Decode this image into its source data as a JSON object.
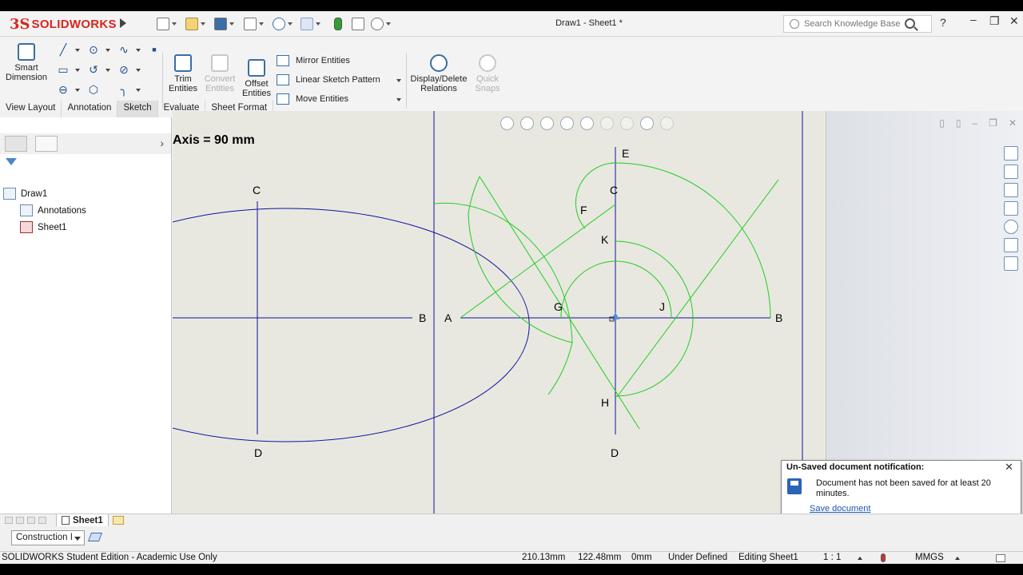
{
  "app": {
    "brand_ds": "3S",
    "brand_name": "SOLIDWORKS",
    "document_title": "Draw1 - Sheet1 *"
  },
  "search": {
    "placeholder": "Search Knowledge Base"
  },
  "command_manager": {
    "smart_dimension": "Smart Dimension",
    "trim_entities": "Trim Entities",
    "convert_entities": "Convert Entities",
    "offset_entities": "Offset Entities",
    "mirror_entities": "Mirror Entities",
    "linear_sketch_pattern": "Linear Sketch Pattern",
    "move_entities": "Move Entities",
    "display_delete_relations": "Display/Delete Relations",
    "quick_snaps": "Quick Snaps"
  },
  "tabs": [
    {
      "label": "View Layout",
      "active": false
    },
    {
      "label": "Annotation",
      "active": false
    },
    {
      "label": "Sketch",
      "active": true
    },
    {
      "label": "Evaluate",
      "active": false
    },
    {
      "label": "Sheet Format",
      "active": false
    }
  ],
  "feature_tree": {
    "root": "Draw1",
    "items": [
      "Annotations",
      "Sheet1"
    ]
  },
  "drawing": {
    "axis_text": "Axis = 90 mm",
    "left_labels": {
      "c": "C",
      "b": "B",
      "d": "D"
    },
    "right_labels": {
      "a": "A",
      "b": "B",
      "c": "C",
      "d": "D",
      "e": "E",
      "f": "F",
      "g": "G",
      "h": "H",
      "j": "J",
      "k": "K"
    },
    "colors": {
      "sheet_line": "#1010a0",
      "construction": "#22cc22",
      "background": "#e8e8e0"
    }
  },
  "notification": {
    "title": "Un-Saved document notification:",
    "body": "Document has not been saved for at least 20 minutes.",
    "link": "Save document"
  },
  "sheet_tab": "Sheet1",
  "layer": {
    "value": "Construction I"
  },
  "status": {
    "edition": "SOLIDWORKS Student Edition - Academic Use Only",
    "x": "210.13mm",
    "y": "122.48mm",
    "z": "0mm",
    "definition": "Under Defined",
    "editing": "Editing Sheet1",
    "scale": "1 : 1",
    "units": "MMGS"
  }
}
